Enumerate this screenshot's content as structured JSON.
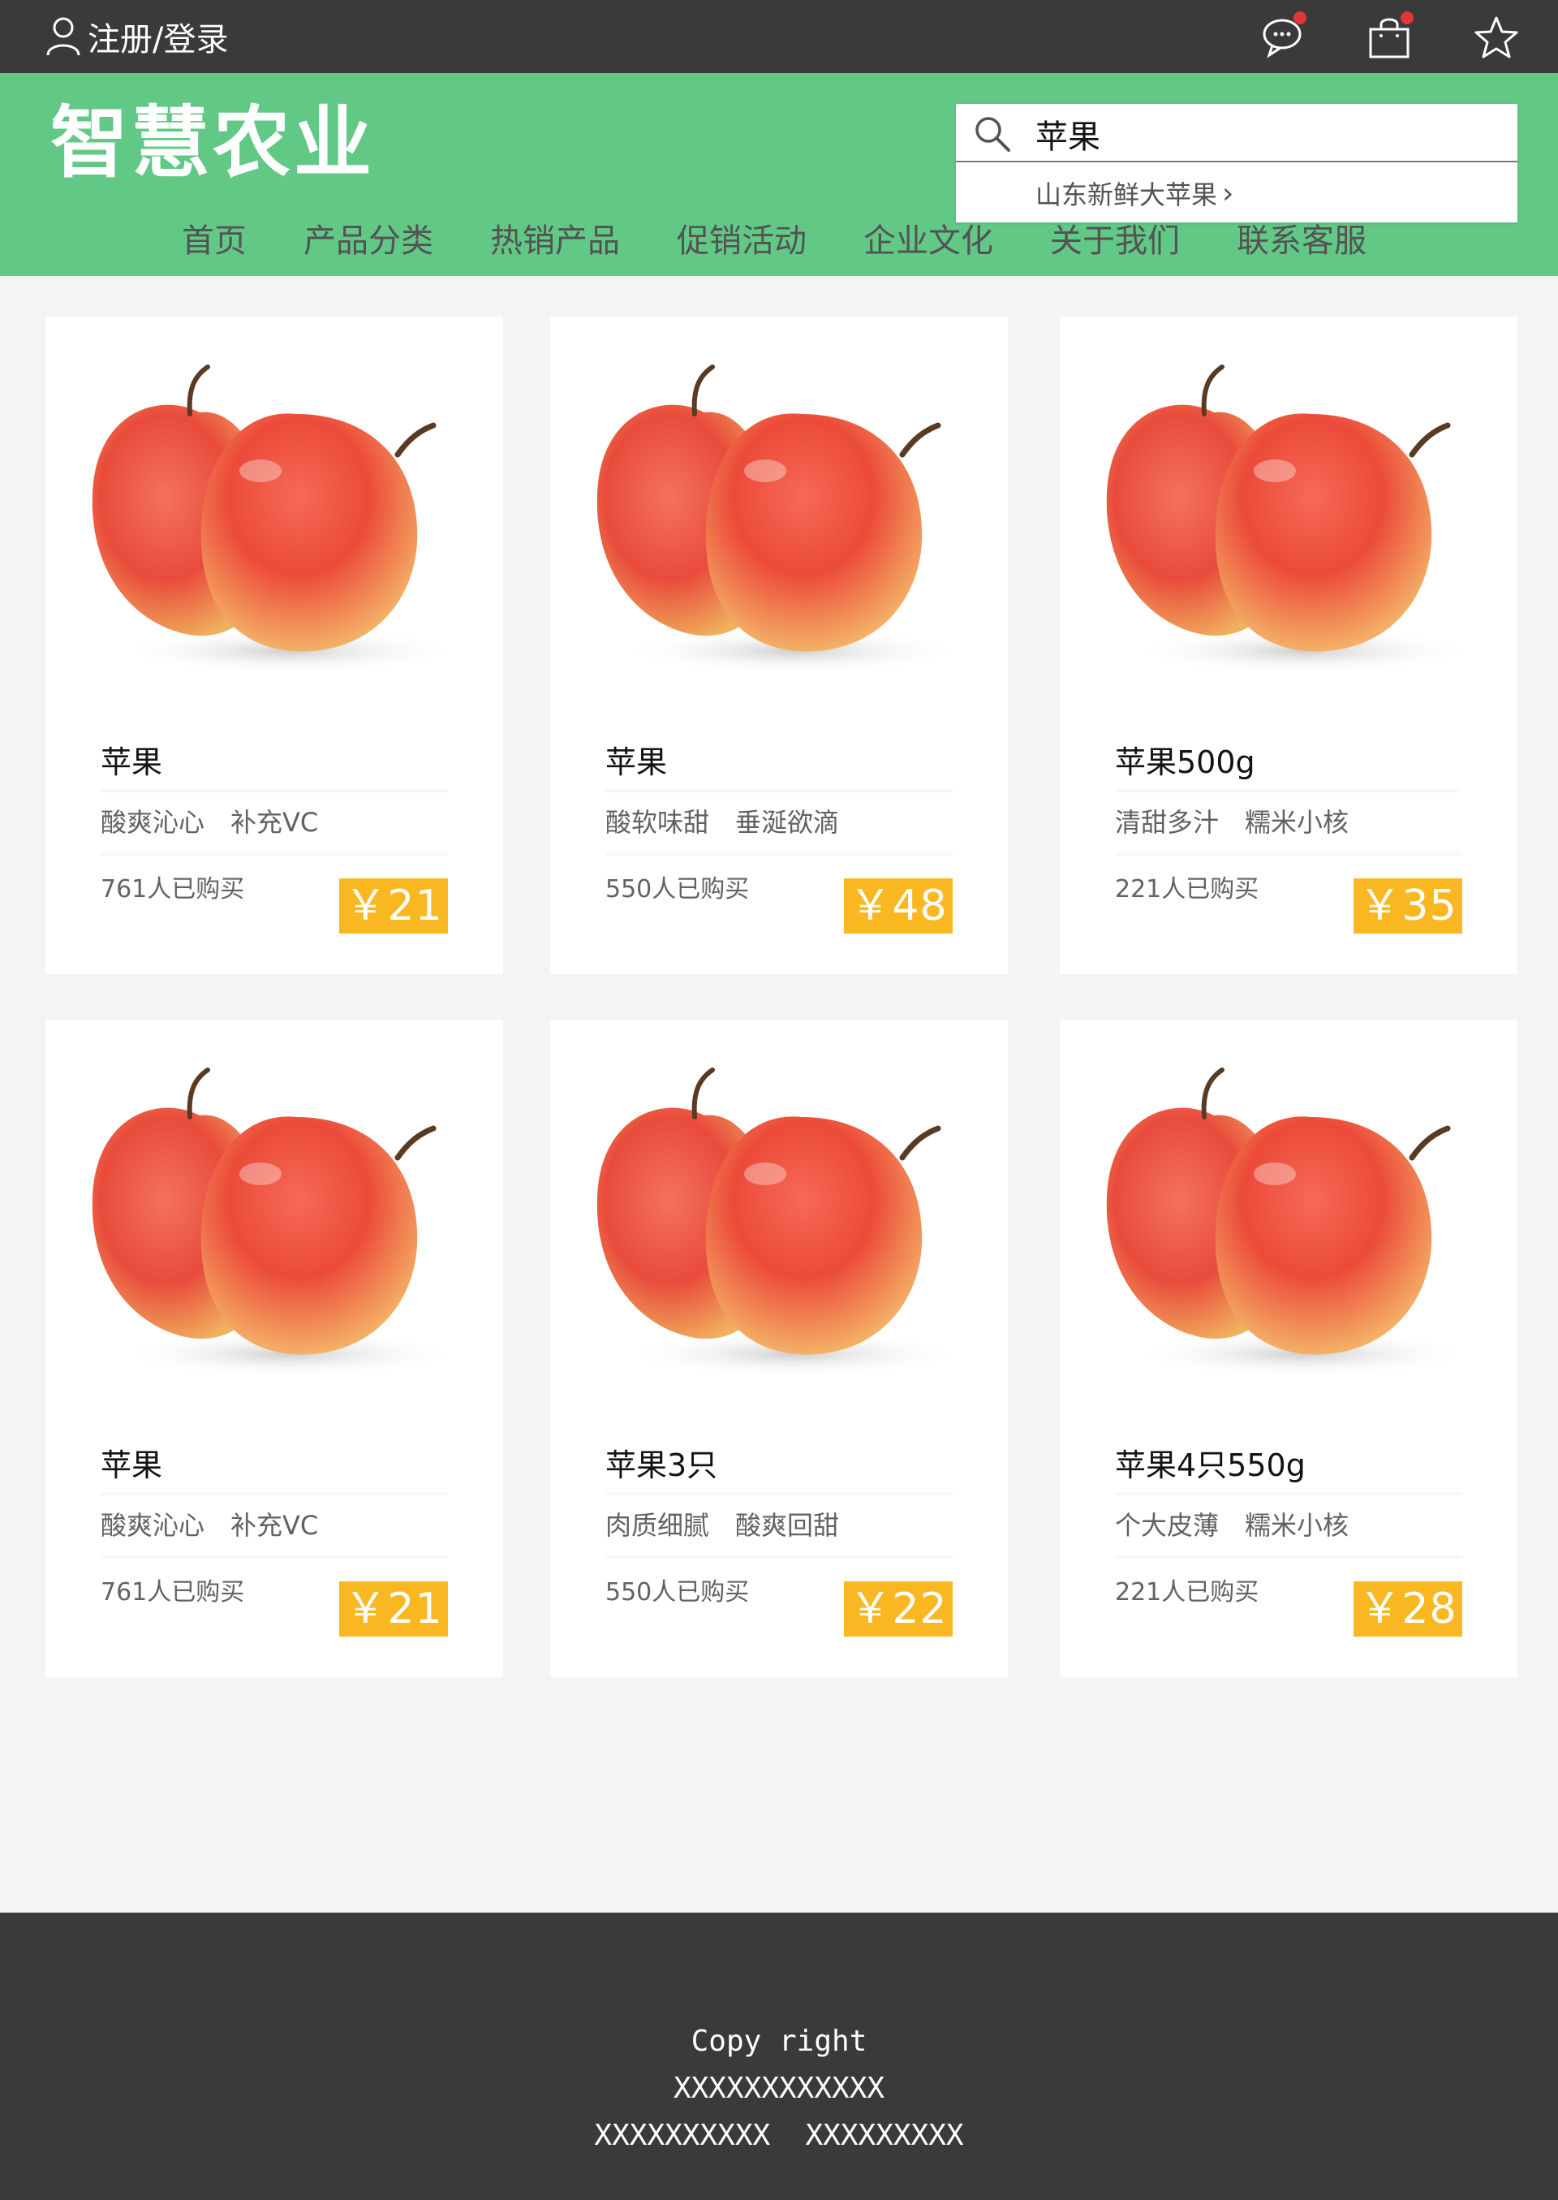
{
  "topbar": {
    "login_label": "注册/登录"
  },
  "header": {
    "logo": "智慧农业",
    "search": {
      "value": "苹果",
      "suggestion": "山东新鲜大苹果"
    },
    "nav": [
      "首页",
      "产品分类",
      "热销产品",
      "促销活动",
      "企业文化",
      "关于我们",
      "联系客服"
    ]
  },
  "products": [
    {
      "title": "苹果",
      "desc": "酸爽沁心　补充VC",
      "bought": "761人已购买",
      "price": "￥21"
    },
    {
      "title": "苹果",
      "desc": "酸软味甜　垂涎欲滴",
      "bought": "550人已购买",
      "price": "￥48"
    },
    {
      "title": "苹果500g",
      "desc": "清甜多汁　糯米小核",
      "bought": "221人已购买",
      "price": "￥35"
    },
    {
      "title": "苹果",
      "desc": "酸爽沁心　补充VC",
      "bought": "761人已购买",
      "price": "￥21"
    },
    {
      "title": "苹果3只",
      "desc": "肉质细腻　酸爽回甜",
      "bought": "550人已购买",
      "price": "￥22"
    },
    {
      "title": "苹果4只550g",
      "desc": "个大皮薄　糯米小核",
      "bought": "221人已购买",
      "price": "￥28"
    }
  ],
  "footer": {
    "line1": "Copy right",
    "line2": "XXXXXXXXXXXX",
    "line3": "XXXXXXXXXX  XXXXXXXXX"
  },
  "colors": {
    "header_green": "#61c886",
    "topbar_dark": "#3a3a3a",
    "price_bg": "#f9b822",
    "badge_red": "#e3343a"
  }
}
